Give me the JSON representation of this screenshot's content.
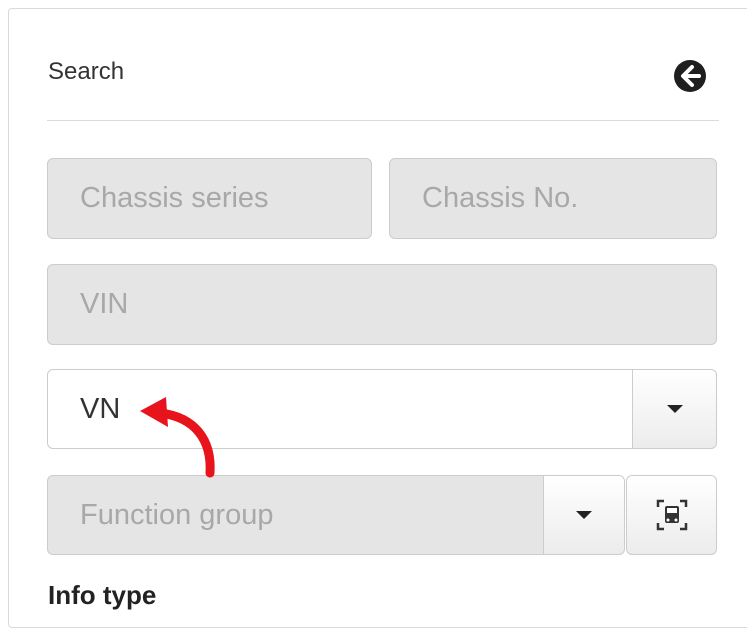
{
  "header": {
    "title": "Search",
    "back_icon": "arrow-left-circle-icon"
  },
  "fields": {
    "chassis_series_placeholder": "Chassis series",
    "chassis_no_placeholder": "Chassis No.",
    "vin_placeholder": "VIN",
    "vn_value": "VN",
    "function_group_placeholder": "Function group"
  },
  "section": {
    "info_type_label": "Info type"
  },
  "annotation": {
    "arrow_color": "#e8141b"
  },
  "colors": {
    "disabled_field_bg": "#e5e5e5",
    "border": "#cccccc"
  }
}
